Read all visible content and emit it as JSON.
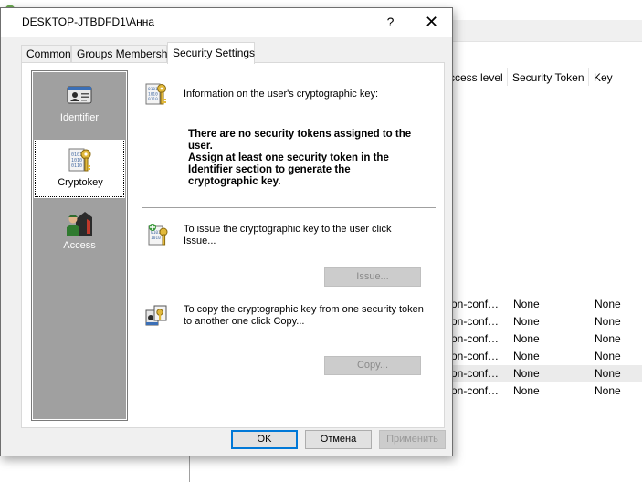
{
  "background": {
    "columns": [
      "ccess level",
      "Security Token",
      "Key"
    ],
    "rows": [
      {
        "access": "on-conf…",
        "token": "None",
        "key": "None",
        "selected": false
      },
      {
        "access": "on-conf…",
        "token": "None",
        "key": "None",
        "selected": false
      },
      {
        "access": "on-conf…",
        "token": "None",
        "key": "None",
        "selected": false
      },
      {
        "access": "on-conf…",
        "token": "None",
        "key": "None",
        "selected": false
      },
      {
        "access": "on-conf…",
        "token": "None",
        "key": "None",
        "selected": true
      },
      {
        "access": "on-conf…",
        "token": "None",
        "key": "None",
        "selected": false
      }
    ]
  },
  "dialog": {
    "title": "DESKTOP-JTBDFD1\\Анна",
    "help_glyph": "?",
    "close_glyph": "✕",
    "tabs": [
      {
        "label": "Common",
        "active": false
      },
      {
        "label": "Groups Membership",
        "active": false
      },
      {
        "label": "Security Settings",
        "active": true
      }
    ],
    "sidebar": [
      {
        "label": "Identifier",
        "icon": "id-card-icon",
        "active": false
      },
      {
        "label": "Cryptokey",
        "icon": "cryptokey-icon",
        "active": true
      },
      {
        "label": "Access",
        "icon": "access-icon",
        "active": false
      }
    ],
    "info_heading": "Information on the user's cryptographic key:",
    "no_token_line1": "There are no security tokens assigned to the",
    "no_token_line2": "user.",
    "no_token_line3": "Assign at least one security token in the",
    "no_token_line4": "Identifier section to generate the",
    "no_token_line5": "cryptographic key.",
    "issue_text_line1": "To issue the cryptographic key to the user click",
    "issue_text_line2": "Issue...",
    "issue_button": "Issue...",
    "copy_text_line1": "To copy the cryptographic key from one security token",
    "copy_text_line2": "to another one click Copy...",
    "copy_button": "Copy...",
    "ok_button": "OK",
    "cancel_button": "Отмена",
    "apply_button": "Применить"
  }
}
